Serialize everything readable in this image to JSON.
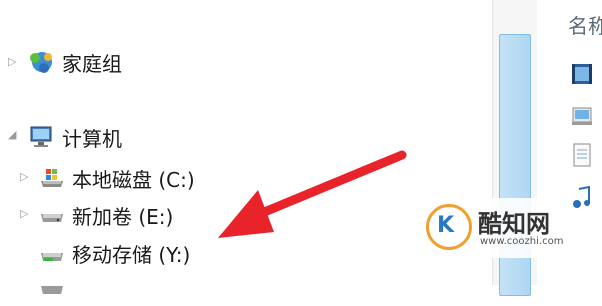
{
  "nav": {
    "items": [
      {
        "label": "家庭组",
        "icon": "homegroup-icon"
      },
      {
        "label": "计算机",
        "icon": "computer-icon"
      },
      {
        "label": "本地磁盘 (C:)",
        "icon": "windows-drive-icon"
      },
      {
        "label": "新加卷 (E:)",
        "icon": "drive-icon"
      },
      {
        "label": "移动存储 (Y:)",
        "icon": "removable-drive-icon"
      },
      {
        "label": "",
        "icon": "drive-icon"
      }
    ]
  },
  "content": {
    "column_header": "名称",
    "file_icons": [
      "video-file-icon",
      "image-file-icon",
      "document-file-icon",
      "music-file-icon"
    ]
  },
  "watermark": {
    "name": "酷知网",
    "url": "www.coozhi.com",
    "logo_text": "K"
  },
  "colors": {
    "arrow": "#e8232a",
    "scroll_thumb": "#b9ddf5",
    "watermark_orange": "#f0a030"
  }
}
